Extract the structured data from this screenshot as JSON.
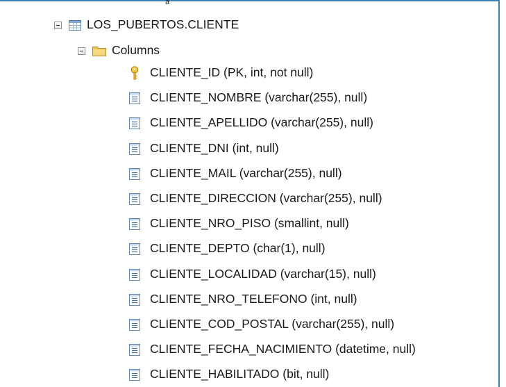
{
  "cutoff_glyph": "a",
  "table": {
    "label": "LOS_PUBERTOS.CLIENTE",
    "icon": "table-icon",
    "expanded": true
  },
  "columns_folder": {
    "label": "Columns",
    "icon": "folder-icon",
    "expanded": true
  },
  "columns": [
    {
      "name": "CLIENTE_ID",
      "spec": " (PK, int, not null)",
      "icon": "primary-key-icon"
    },
    {
      "name": "CLIENTE_NOMBRE",
      "spec": " (varchar(255), null)",
      "icon": "column-icon"
    },
    {
      "name": "CLIENTE_APELLIDO",
      "spec": " (varchar(255), null)",
      "icon": "column-icon"
    },
    {
      "name": "CLIENTE_DNI",
      "spec": " (int, null)",
      "icon": "column-icon"
    },
    {
      "name": "CLIENTE_MAIL",
      "spec": " (varchar(255), null)",
      "icon": "column-icon"
    },
    {
      "name": "CLIENTE_DIRECCION",
      "spec": " (varchar(255), null)",
      "icon": "column-icon"
    },
    {
      "name": "CLIENTE_NRO_PISO",
      "spec": " (smallint, null)",
      "icon": "column-icon"
    },
    {
      "name": "CLIENTE_DEPTO",
      "spec": " (char(1), null)",
      "icon": "column-icon"
    },
    {
      "name": "CLIENTE_LOCALIDAD",
      "spec": " (varchar(15), null)",
      "icon": "column-icon"
    },
    {
      "name": "CLIENTE_NRO_TELEFONO",
      "spec": " (int, null)",
      "icon": "column-icon"
    },
    {
      "name": "CLIENTE_COD_POSTAL",
      "spec": " (varchar(255), null)",
      "icon": "column-icon"
    },
    {
      "name": "CLIENTE_FECHA_NACIMIENTO",
      "spec": " (datetime, null)",
      "icon": "column-icon"
    },
    {
      "name": "CLIENTE_HABILITADO",
      "spec": " (bit, null)",
      "icon": "column-icon"
    }
  ],
  "colors": {
    "frame_border": "#3c7fb1",
    "folder": "#e8c35a",
    "key": "#e2a621",
    "column_icon_border": "#5f86b3"
  }
}
